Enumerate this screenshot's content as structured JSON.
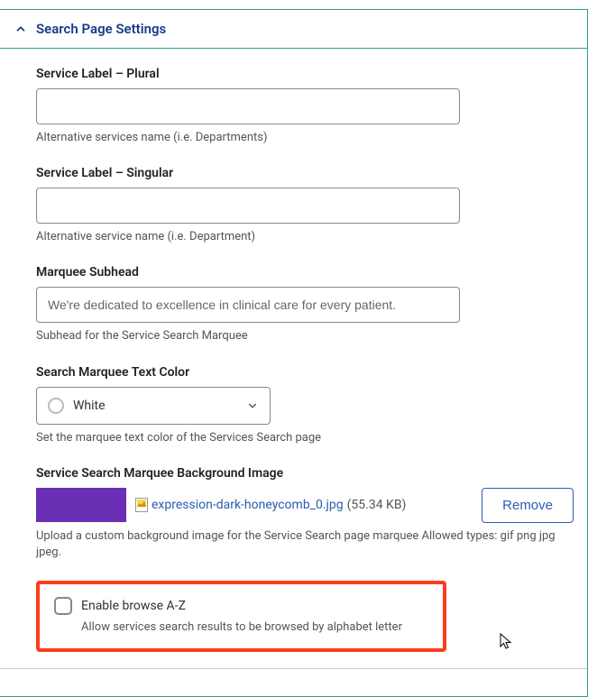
{
  "panel": {
    "title": "Search Page Settings"
  },
  "fields": {
    "plural": {
      "label": "Service Label – Plural",
      "value": "",
      "help": "Alternative services name (i.e. Departments)"
    },
    "singular": {
      "label": "Service Label – Singular",
      "value": "",
      "help": "Alternative service name (i.e. Department)"
    },
    "subhead": {
      "label": "Marquee Subhead",
      "value": "We're dedicated to excellence in clinical care for every patient.",
      "help": "Subhead for the Service Search Marquee"
    },
    "textcolor": {
      "label": "Search Marquee Text Color",
      "value": "White",
      "help": "Set the marquee text color of the Services Search page"
    },
    "bgimage": {
      "label": "Service Search Marquee Background Image",
      "filename": "expression-dark-honeycomb_0.jpg",
      "filesize": "(55.34 KB)",
      "remove": "Remove",
      "help": "Upload a custom background image for the Service Search page marquee Allowed types: gif png jpg jpeg."
    },
    "browse": {
      "label": "Enable browse A-Z",
      "help": "Allow services search results to be browsed by alphabet letter"
    }
  }
}
